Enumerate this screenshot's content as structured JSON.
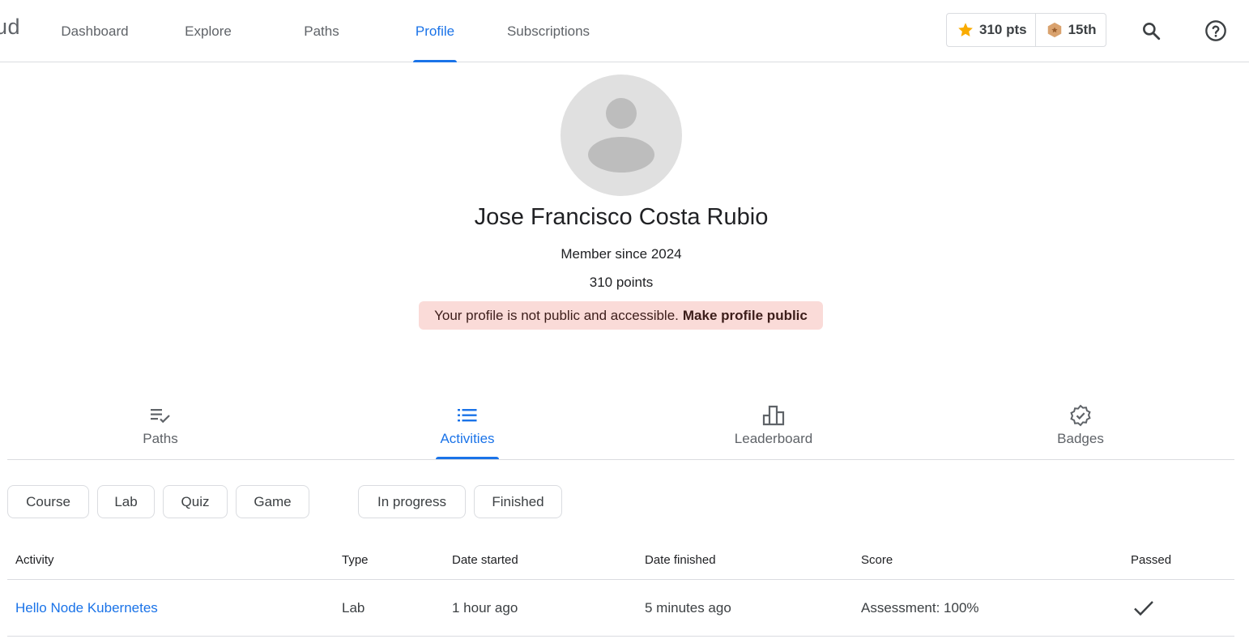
{
  "header": {
    "brand_fragment": "ud",
    "nav": [
      {
        "label": "Dashboard"
      },
      {
        "label": "Explore"
      },
      {
        "label": "Paths"
      },
      {
        "label": "Profile"
      },
      {
        "label": "Subscriptions"
      }
    ],
    "active_nav": "Profile",
    "points_label": "310 pts",
    "rank_label": "15th",
    "search_icon": "search-icon",
    "help_icon": "help-icon"
  },
  "profile": {
    "name": "Jose Francisco Costa Rubio",
    "member_since": "Member since 2024",
    "points": "310 points",
    "notice_text": "Your profile is not public and accessible.",
    "notice_link": "Make profile public"
  },
  "section_tabs": [
    {
      "label": "Paths",
      "icon": "playlist-check-icon"
    },
    {
      "label": "Activities",
      "icon": "list-icon"
    },
    {
      "label": "Leaderboard",
      "icon": "leaderboard-icon"
    },
    {
      "label": "Badges",
      "icon": "verified-badge-icon"
    }
  ],
  "active_section_tab": "Activities",
  "filters": {
    "type": [
      "Course",
      "Lab",
      "Quiz",
      "Game"
    ],
    "status": [
      "In progress",
      "Finished"
    ]
  },
  "table": {
    "columns": [
      "Activity",
      "Type",
      "Date started",
      "Date finished",
      "Score",
      "Passed"
    ],
    "rows": [
      {
        "activity": "Hello Node Kubernetes",
        "type": "Lab",
        "date_started": "1 hour ago",
        "date_finished": "5 minutes ago",
        "score": "Assessment: 100%",
        "passed": true
      }
    ]
  },
  "colors": {
    "accent": "#1a73e8",
    "star": "#f9ab00",
    "rank_badge": "#d9a26e",
    "notice_bg": "#fadbd8"
  }
}
